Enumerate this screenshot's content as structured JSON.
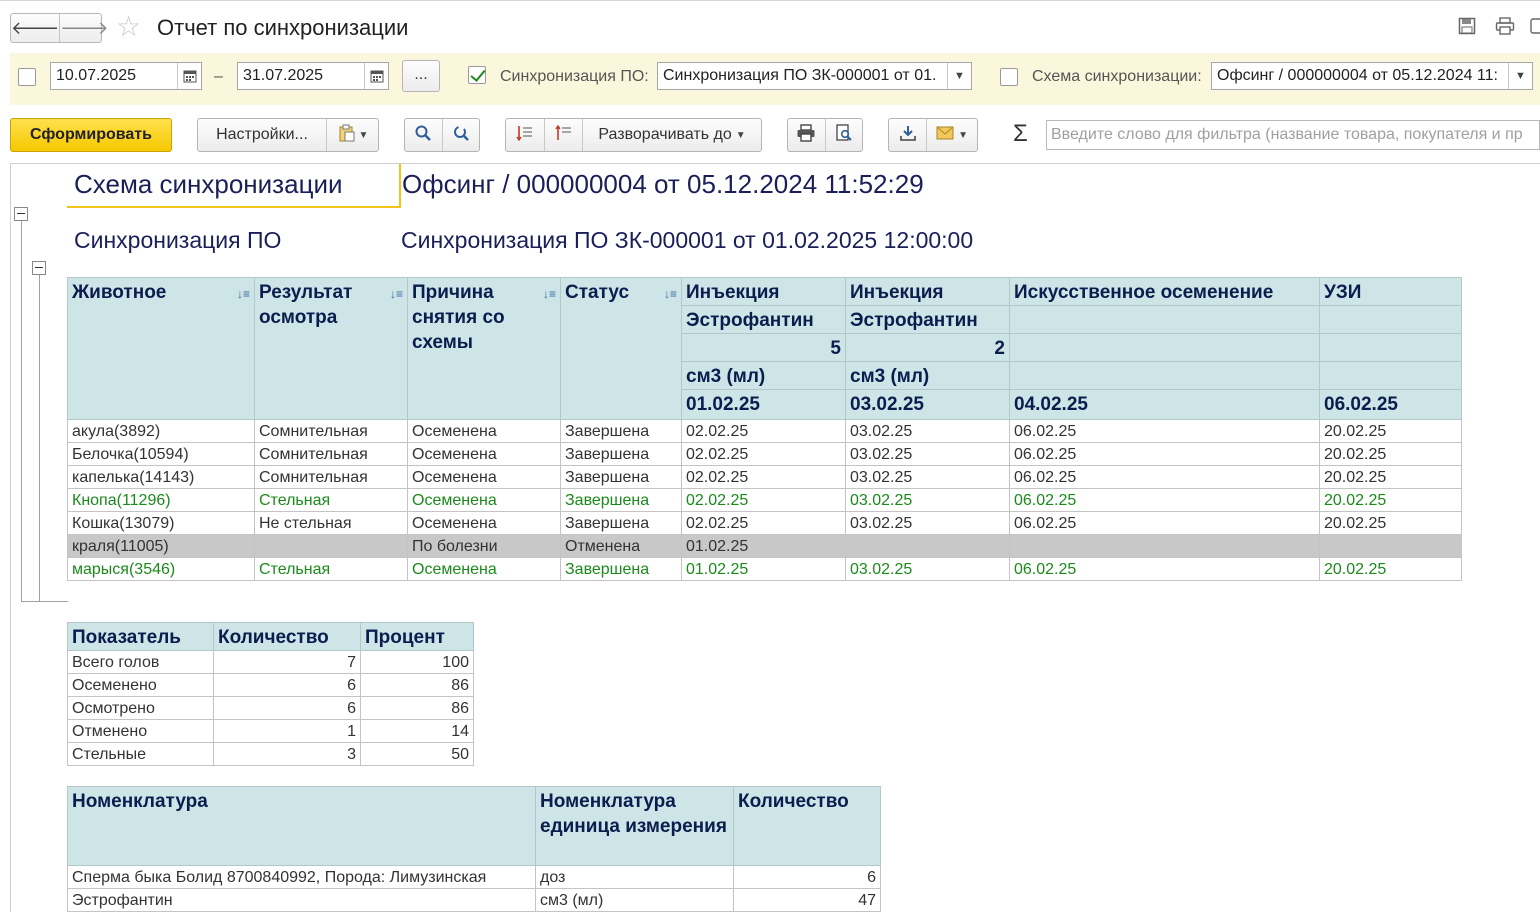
{
  "window": {
    "title": "Отчет по синхронизации",
    "back_glyph": "🡐",
    "forward_glyph": "🡒",
    "favorite_glyph": "☆",
    "icons": [
      "save-icon",
      "print-icon"
    ]
  },
  "filters": {
    "date_from": "10.07.2025",
    "date_to": "31.07.2025",
    "date_separator": "–",
    "period_button": "...",
    "sync_label": "Синхронизация ПО:",
    "sync_value": "Синхронизация ПО ЗК-000001 от 01.",
    "scheme_label": "Схема синхронизации:",
    "scheme_value": "Офсинг / 000000004 от 05.12.2024 11:"
  },
  "toolbar": {
    "generate_label": "Сформировать",
    "settings_label": "Настройки...",
    "expand_label": "Разворачивать до",
    "sigma": "Σ",
    "filter_placeholder": "Введите слово для фильтра (название товара, покупателя и пр"
  },
  "report": {
    "scheme_label": "Схема синхронизации",
    "scheme_value": "Офсинг / 000000004 от 05.12.2024 11:52:29",
    "sync_label": "Синхронизация ПО",
    "sync_value": "Синхронизация ПО ЗК-000001 от 01.02.2025 12:00:00",
    "main_table": {
      "headers": [
        "Животное",
        "Результат осмотра",
        "Причина снятия со схемы",
        "Статус"
      ],
      "events": [
        {
          "name": "Инъекция",
          "drug": "Эстрофантин",
          "qty": "5",
          "unit": "см3 (мл)",
          "date": "01.02.25"
        },
        {
          "name": "Инъекция",
          "drug": "Эстрофантин",
          "qty": "2",
          "unit": "см3 (мл)",
          "date": "03.02.25"
        },
        {
          "name": "Искусственное осеменение",
          "drug": "",
          "qty": "",
          "unit": "",
          "date": "04.02.25"
        },
        {
          "name": "УЗИ",
          "drug": "",
          "qty": "",
          "unit": "",
          "date": "06.02.25"
        }
      ],
      "rows": [
        {
          "style": "",
          "cells": [
            "акула(3892)",
            "Сомнительная",
            "Осеменена",
            "Завершена",
            "02.02.25",
            "03.02.25",
            "06.02.25",
            "20.02.25"
          ]
        },
        {
          "style": "",
          "cells": [
            "Белочка(10594)",
            "Сомнительная",
            "Осеменена",
            "Завершена",
            "02.02.25",
            "03.02.25",
            "06.02.25",
            "20.02.25"
          ]
        },
        {
          "style": "",
          "cells": [
            "капелька(14143)",
            "Сомнительная",
            "Осеменена",
            "Завершена",
            "02.02.25",
            "03.02.25",
            "06.02.25",
            "20.02.25"
          ]
        },
        {
          "style": "green",
          "cells": [
            "Кнопа(11296)",
            "Стельная",
            "Осеменена",
            "Завершена",
            "02.02.25",
            "03.02.25",
            "06.02.25",
            "20.02.25"
          ]
        },
        {
          "style": "",
          "cells": [
            "Кошка(13079)",
            "Не стельная",
            "Осеменена",
            "Завершена",
            "02.02.25",
            "03.02.25",
            "06.02.25",
            "20.02.25"
          ]
        },
        {
          "style": "grey",
          "cells": [
            "краля(11005)",
            "",
            "По болезни",
            "Отменена",
            "01.02.25",
            "",
            "",
            ""
          ]
        },
        {
          "style": "green",
          "cells": [
            "марыся(3546)",
            "Стельная",
            "Осеменена",
            "Завершена",
            "01.02.25",
            "03.02.25",
            "06.02.25",
            "20.02.25"
          ]
        }
      ]
    },
    "summary_table": {
      "headers": [
        "Показатель",
        "Количество",
        "Процент"
      ],
      "rows": [
        [
          "Всего голов",
          "7",
          "100"
        ],
        [
          "Осеменено",
          "6",
          "86"
        ],
        [
          "Осмотрено",
          "6",
          "86"
        ],
        [
          "Отменено",
          "1",
          "14"
        ],
        [
          "Стельные",
          "3",
          "50"
        ]
      ]
    },
    "nomenclature_table": {
      "headers": [
        "Номенклатура",
        "Номенклатура единица измерения",
        "Количество"
      ],
      "rows": [
        [
          "Сперма быка Болид 8700840992,  Порода: Лимузинская",
          "доз",
          "6"
        ],
        [
          "Эстрофантин",
          "см3 (мл)",
          "47"
        ]
      ]
    }
  }
}
